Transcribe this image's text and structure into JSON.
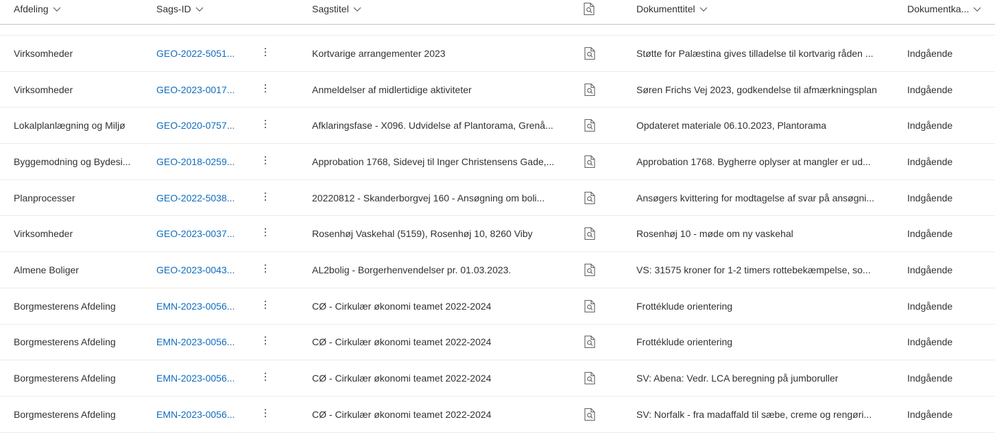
{
  "columns": {
    "afdeling": "Afdeling",
    "sags_id": "Sags-ID",
    "sagstitel": "Sagstitel",
    "dokumenttitel": "Dokumenttitel",
    "dokumentkategori": "Dokumentka..."
  },
  "icons": {
    "sort": "chevron-down-icon",
    "preview": "document-search-icon",
    "more": "more-vertical-icon"
  },
  "colors": {
    "link": "#0f6cbd",
    "text": "#323130",
    "divider": "#edebe9"
  },
  "rows": [
    {
      "afdeling": "Virksomheder",
      "sags_id": "GEO-2022-5051...",
      "sagstitel": "Kortvarige arrangementer 2023",
      "dokumenttitel": "Støtte for Palæstina gives tilladelse til kortvarig råden ...",
      "kategori": "Indgående"
    },
    {
      "afdeling": "Virksomheder",
      "sags_id": "GEO-2023-0017...",
      "sagstitel": "Anmeldelser af midlertidige aktiviteter",
      "dokumenttitel": "Søren Frichs Vej 2023, godkendelse til afmærkningsplan",
      "kategori": "Indgående"
    },
    {
      "afdeling": "Lokalplanlægning og Miljø",
      "sags_id": "GEO-2020-0757...",
      "sagstitel": "Afklaringsfase - X096. Udvidelse af Plantorama, Grenå...",
      "dokumenttitel": "Opdateret materiale 06.10.2023, Plantorama",
      "kategori": "Indgående"
    },
    {
      "afdeling": "Byggemodning og Bydesi...",
      "sags_id": "GEO-2018-0259...",
      "sagstitel": "Approbation 1768, Sidevej til Inger Christensens Gade,...",
      "dokumenttitel": "Approbation 1768. Bygherre oplyser at mangler er ud...",
      "kategori": "Indgående"
    },
    {
      "afdeling": "Planprocesser",
      "sags_id": "GEO-2022-5038...",
      "sagstitel": "20220812 - Skanderborgvej 160 - Ansøgning om boli...",
      "dokumenttitel": "Ansøgers kvittering for modtagelse af svar på ansøgni...",
      "kategori": "Indgående"
    },
    {
      "afdeling": "Virksomheder",
      "sags_id": "GEO-2023-0037...",
      "sagstitel": "Rosenhøj Vaskehal (5159), Rosenhøj 10, 8260 Viby",
      "dokumenttitel": "Rosenhøj 10 - møde om ny vaskehal",
      "kategori": "Indgående"
    },
    {
      "afdeling": "Almene Boliger",
      "sags_id": "GEO-2023-0043...",
      "sagstitel": "AL2bolig - Borgerhenvendelser pr. 01.03.2023.",
      "dokumenttitel": "VS: 31575 kroner for 1-2 timers rottebekæmpelse, so...",
      "kategori": "Indgående"
    },
    {
      "afdeling": "Borgmesterens Afdeling",
      "sags_id": "EMN-2023-0056...",
      "sagstitel": "CØ - Cirkulær økonomi teamet 2022-2024",
      "dokumenttitel": "Frottéklude orientering",
      "kategori": "Indgående"
    },
    {
      "afdeling": "Borgmesterens Afdeling",
      "sags_id": "EMN-2023-0056...",
      "sagstitel": "CØ - Cirkulær økonomi teamet 2022-2024",
      "dokumenttitel": "Frottéklude orientering",
      "kategori": "Indgående"
    },
    {
      "afdeling": "Borgmesterens Afdeling",
      "sags_id": "EMN-2023-0056...",
      "sagstitel": "CØ - Cirkulær økonomi teamet 2022-2024",
      "dokumenttitel": "SV: Abena: Vedr. LCA beregning på jumboruller",
      "kategori": "Indgående"
    },
    {
      "afdeling": "Borgmesterens Afdeling",
      "sags_id": "EMN-2023-0056...",
      "sagstitel": "CØ - Cirkulær økonomi teamet 2022-2024",
      "dokumenttitel": "SV: Norfalk - fra madaffald til sæbe, creme og rengøri...",
      "kategori": "Indgående"
    }
  ]
}
